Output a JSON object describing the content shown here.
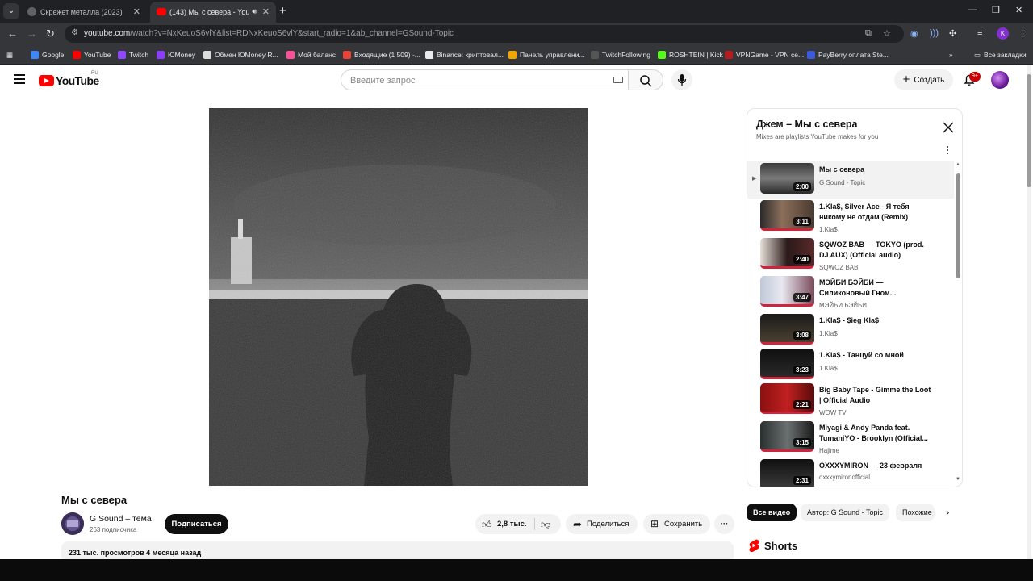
{
  "browser": {
    "tabs": [
      {
        "title": "Скрежет металла (2023)",
        "active": false
      },
      {
        "title": "(143) Мы с севера - YouTube",
        "active": true
      }
    ],
    "url_host": "youtube.com",
    "url_path": "/watch?v=NxKeuoS6vlY&list=RDNxKeuoS6vlY&start_radio=1&ab_channel=GSound-Topic",
    "profile_initial": "K",
    "bookmarks": [
      {
        "label": "Google",
        "color": "#4285f4"
      },
      {
        "label": "YouTube",
        "color": "#ff0000"
      },
      {
        "label": "Twitch",
        "color": "#9146ff"
      },
      {
        "label": "ЮMoney",
        "color": "#8b3ffd"
      },
      {
        "label": "Обмен ЮMoney R...",
        "color": "#dddddd"
      },
      {
        "label": "Мой баланс",
        "color": "#ff4f9a"
      },
      {
        "label": "Входящие (1 509) -...",
        "color": "#ea4335"
      },
      {
        "label": "Binance: криптовал...",
        "color": "#e8eaed"
      },
      {
        "label": "Панель управлени...",
        "color": "#f0a500"
      },
      {
        "label": "TwitchFollowing",
        "color": "#555555"
      },
      {
        "label": "ROSHTEIN | Kick",
        "color": "#53fc18"
      },
      {
        "label": "VPNGame - VPN се...",
        "color": "#b71c1c"
      },
      {
        "label": "PayBerry оплата Ste...",
        "color": "#3b5bdb"
      }
    ],
    "all_bookmarks": "Все закладки"
  },
  "youtube": {
    "logo_text": "YouTube",
    "region": "RU",
    "search_placeholder": "Введите запрос",
    "create_label": "Создать",
    "notif_badge": "9+"
  },
  "video": {
    "title": "Мы с севера",
    "channel": "G Sound – тема",
    "subscribers": "263 подписчика",
    "subscribe_label": "Подписаться",
    "likes": "2,8 тыс.",
    "share_label": "Поделиться",
    "save_label": "Сохранить",
    "views_meta": "231 тыс. просмотров  4 месяца назад"
  },
  "mix": {
    "title": "Джем – Мы с севера",
    "subtitle": "Mixes are playlists YouTube makes for you",
    "items": [
      {
        "title": "Мы с севера",
        "author": "G Sound - Topic",
        "duration": "2:00",
        "active": true
      },
      {
        "title": "1.Kla$, Silver Ace - Я тебя никому не отдам (Remix)",
        "author": "1.Kla$",
        "duration": "3:11"
      },
      {
        "title": "SQWOZ BAB — TOKYO (prod. DJ AUX) (Official audio)",
        "author": "SQWOZ BAB",
        "duration": "2:40"
      },
      {
        "title": "МЭЙБИ БЭЙБИ — Силиконовый Гном...",
        "author": "МЭЙБИ БЭЙБИ",
        "duration": "3:47"
      },
      {
        "title": "1.Kla$ - $ieg Kla$",
        "author": "1.Kla$",
        "duration": "3:08"
      },
      {
        "title": "1.Kla$ - Танцуй со мной",
        "author": "1.Kla$",
        "duration": "3:23"
      },
      {
        "title": "Big Baby Tape - Gimme the Loot | Official Audio",
        "author": "WOW TV",
        "duration": "2:21"
      },
      {
        "title": "Miyagi & Andy Panda feat. TumaniYO - Brooklyn (Official...",
        "author": "Hajime",
        "duration": "3:15"
      },
      {
        "title": "OXXXYMIRON — 23 февраля",
        "author": "oxxxymironofficial",
        "duration": "2:31"
      }
    ]
  },
  "chips": [
    "Все видео",
    "Автор: G Sound - Topic",
    "Похожие"
  ],
  "shorts_label": "Shorts"
}
